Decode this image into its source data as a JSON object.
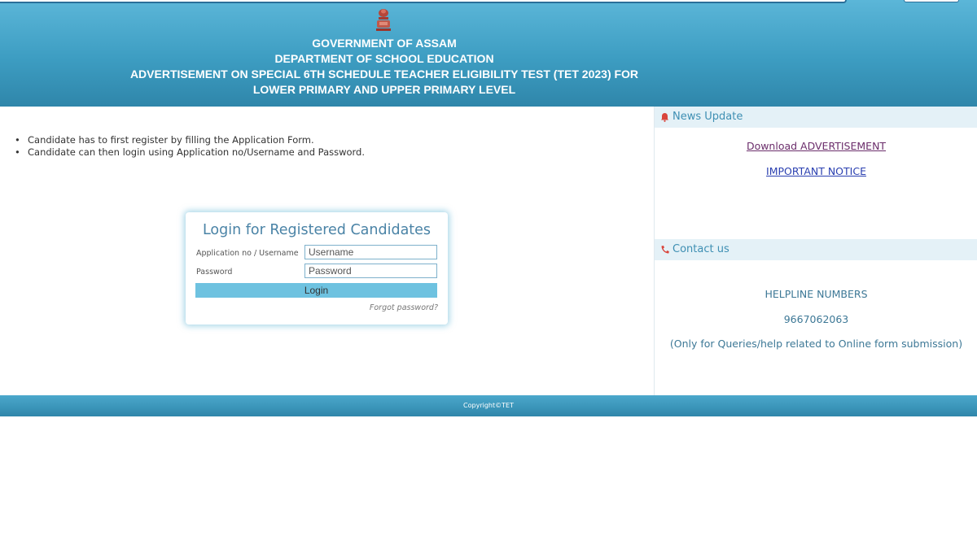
{
  "header": {
    "line1": "GOVERNMENT OF ASSAM",
    "line2": "DEPARTMENT OF SCHOOL EDUCATION",
    "line3": "ADVERTISEMENT ON SPECIAL 6TH SCHEDULE TEACHER ELIGIBILITY TEST (TET 2023) FOR",
    "line4": "LOWER PRIMARY AND UPPER PRIMARY LEVEL",
    "emblem_icon": "state-emblem-icon"
  },
  "instructions": [
    "Candidate has to first register by filling the Application Form.",
    "Candidate can then login using Application no/Username and Password."
  ],
  "login": {
    "title": "Login for Registered Candidates",
    "username_label": "Application no / Username",
    "username_placeholder": "Username",
    "password_label": "Password",
    "password_placeholder": "Password",
    "button": "Login",
    "forgot": "Forgot password?"
  },
  "news": {
    "heading": "News Update",
    "icon": "bell-icon",
    "links": [
      "Download ADVERTISEMENT",
      "IMPORTANT NOTICE"
    ]
  },
  "contact": {
    "heading": "Contact us",
    "icon": "phone-icon",
    "helpline_title": "HELPLINE NUMBERS",
    "number": "9667062063",
    "note": "(Only for Queries/help related to Online form submission)"
  },
  "footer": {
    "copyright": "Copyright©TET"
  },
  "colors": {
    "header_blue": "#3d9dc2",
    "link_visited": "#6b2d6b",
    "link_blue": "#2a3fb0",
    "accent_red": "#d9453c"
  }
}
